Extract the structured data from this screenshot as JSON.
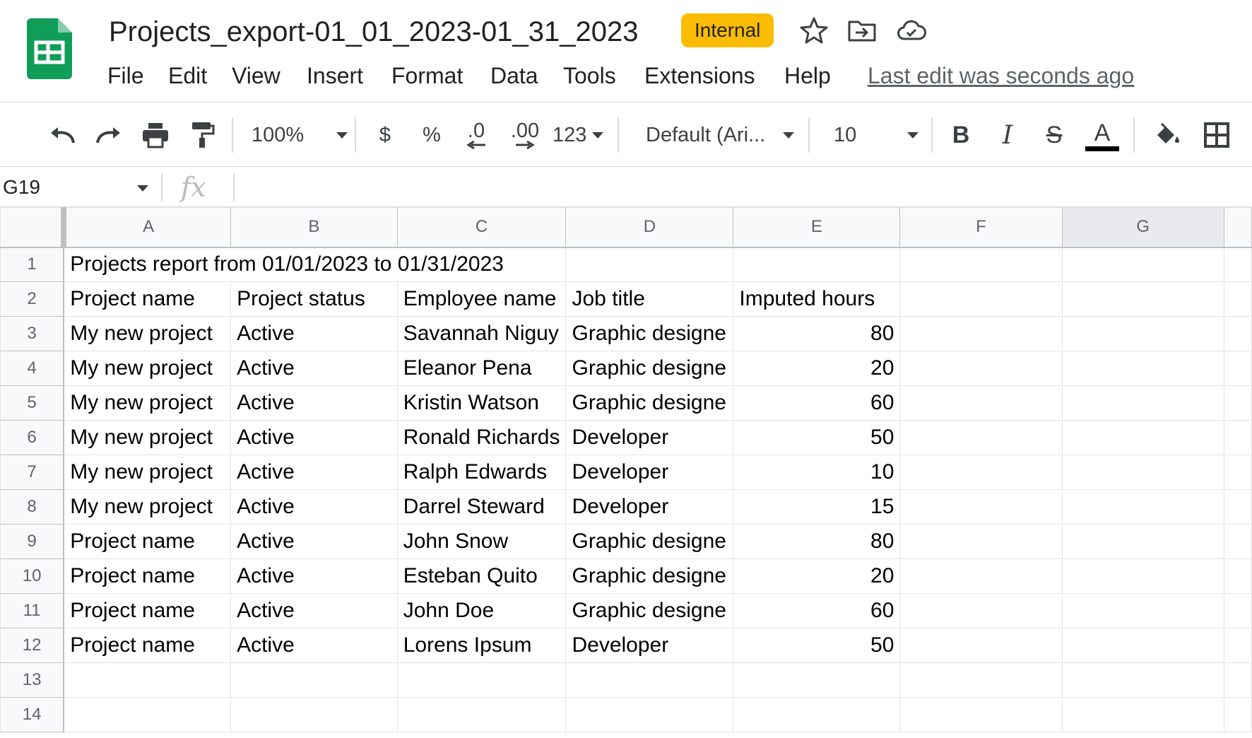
{
  "app": {
    "doc_title": "Projects_export-01_01_2023-01_31_2023",
    "badge": "Internal",
    "last_edit": "Last edit was seconds ago",
    "brand_color": "#0f9d58",
    "badge_color": "#fbbc04"
  },
  "menu": [
    "File",
    "Edit",
    "View",
    "Insert",
    "Format",
    "Data",
    "Tools",
    "Extensions",
    "Help"
  ],
  "toolbar": {
    "zoom": "100%",
    "currency": "$",
    "percent": "%",
    "decrease_decimal": ".0",
    "increase_decimal": ".00",
    "more_formats": "123",
    "font": "Default (Ari...",
    "font_size": "10",
    "bold": "B",
    "italic": "I",
    "strike": "S",
    "text_color": "A",
    "icons": [
      "undo-icon",
      "redo-icon",
      "print-icon",
      "paint-format-icon",
      "fill-color-icon",
      "borders-icon"
    ]
  },
  "formula_bar": {
    "name_box": "G19",
    "fx": "fx",
    "value": ""
  },
  "sheet": {
    "selected_column": "G",
    "columns": [
      "A",
      "B",
      "C",
      "D",
      "E",
      "F",
      "G"
    ],
    "row_numbers": [
      "1",
      "2",
      "3",
      "4",
      "5",
      "6",
      "7",
      "8",
      "9",
      "10",
      "11",
      "12",
      "13",
      "14"
    ],
    "title": "Projects report from 01/01/2023 to 01/31/2023",
    "headers": [
      "Project name",
      "Project status",
      "Employee name",
      "Job title",
      "Imputed hours"
    ],
    "rows": [
      [
        "My new project",
        "Active",
        "Savannah Niguy",
        "Graphic designe",
        "80"
      ],
      [
        "My new project",
        "Active",
        "Eleanor Pena",
        "Graphic designe",
        "20"
      ],
      [
        "My new project",
        "Active",
        "Kristin Watson",
        "Graphic designe",
        "60"
      ],
      [
        "My new project",
        "Active",
        "Ronald Richards",
        "Developer",
        "50"
      ],
      [
        "My new project",
        "Active",
        "Ralph Edwards",
        "Developer",
        "10"
      ],
      [
        "My new project",
        "Active",
        "Darrel Steward",
        "Developer",
        "15"
      ],
      [
        "Project name",
        "Active",
        "John Snow",
        "Graphic designe",
        "80"
      ],
      [
        "Project name",
        "Active",
        "Esteban Quito",
        "Graphic designe",
        "20"
      ],
      [
        "Project name",
        "Active",
        "John Doe",
        "Graphic designe",
        "60"
      ],
      [
        "Project name",
        "Active",
        "Lorens Ipsum",
        "Developer",
        "50"
      ]
    ]
  }
}
